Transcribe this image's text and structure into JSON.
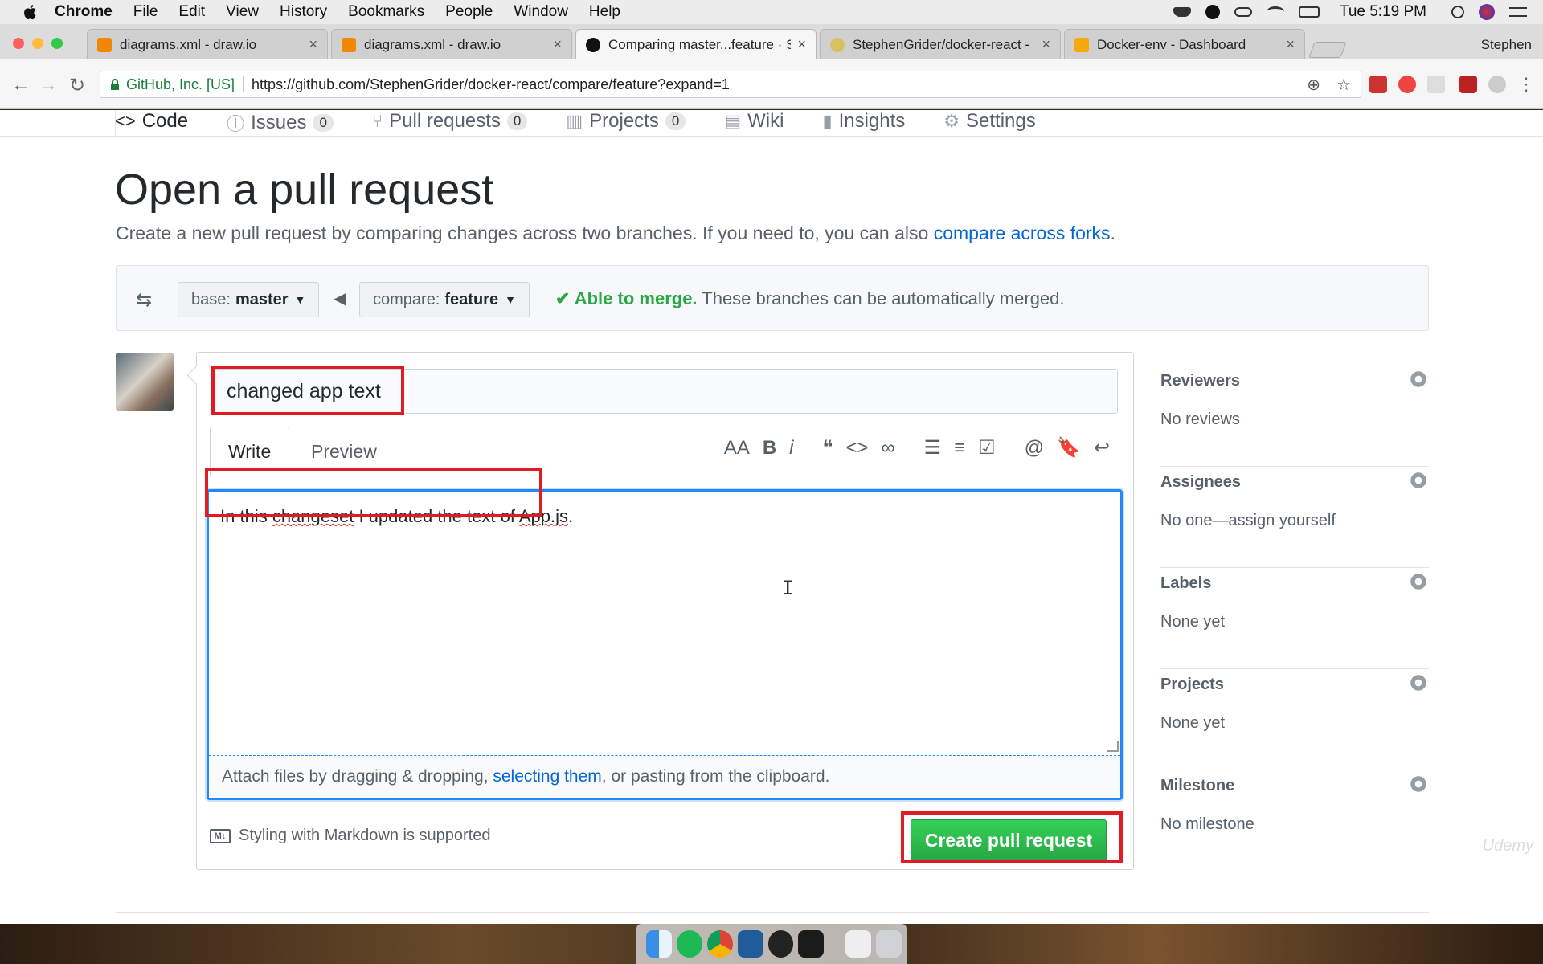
{
  "menubar": {
    "app": "Chrome",
    "items": [
      "File",
      "Edit",
      "View",
      "History",
      "Bookmarks",
      "People",
      "Window",
      "Help"
    ],
    "clock": "Tue 5:19 PM"
  },
  "browser": {
    "tabs": [
      {
        "label": "diagrams.xml - draw.io",
        "icon": "drawio-icon"
      },
      {
        "label": "diagrams.xml - draw.io",
        "icon": "drawio-icon"
      },
      {
        "label": "Comparing master...feature · S",
        "icon": "github-icon"
      },
      {
        "label": "StephenGrider/docker-react -",
        "icon": "travis-icon"
      },
      {
        "label": "Docker-env - Dashboard",
        "icon": "aws-icon"
      }
    ],
    "profile": "Stephen",
    "cert": "GitHub, Inc. [US]",
    "url": "https://github.com/StephenGrider/docker-react/compare/feature?expand=1"
  },
  "repo_nav": {
    "code": "Code",
    "issues": "Issues",
    "issues_count": "0",
    "pulls": "Pull requests",
    "pulls_count": "0",
    "projects": "Projects",
    "projects_count": "0",
    "wiki": "Wiki",
    "insights": "Insights",
    "settings": "Settings"
  },
  "page": {
    "title": "Open a pull request",
    "subtitle": "Create a new pull request by comparing changes across two branches. If you need to, you can also ",
    "subtitle_link": "compare across forks",
    "subtitle_end": "."
  },
  "range": {
    "base_label": "base:",
    "base_branch": "master",
    "compare_label": "compare:",
    "compare_branch": "feature",
    "merge_status": "Able to merge.",
    "merge_detail": "These branches can be automatically merged."
  },
  "form": {
    "title_value": "changed app text",
    "tab_write": "Write",
    "tab_preview": "Preview",
    "body_prefix": "In this ",
    "body_word": "changeset",
    "body_mid": " I updated the text of ",
    "body_file": "App.js",
    "body_end": ".",
    "attach_prefix": "Attach files by dragging & dropping, ",
    "attach_link": "selecting them",
    "attach_suffix": ", or pasting from the clipboard.",
    "markdown_note": "Styling with Markdown is supported",
    "markdown_badge": "M↓",
    "submit": "Create pull request"
  },
  "sidebar": {
    "sections": [
      {
        "title": "Reviewers",
        "value": "No reviews"
      },
      {
        "title": "Assignees",
        "value": "No one—assign yourself"
      },
      {
        "title": "Labels",
        "value": "None yet"
      },
      {
        "title": "Projects",
        "value": "None yet"
      },
      {
        "title": "Milestone",
        "value": "No milestone"
      }
    ]
  },
  "watermark": "Udemy",
  "colors": {
    "primary_green": "#28a745",
    "link_blue": "#0366d6",
    "highlight_red": "#e01b24"
  }
}
